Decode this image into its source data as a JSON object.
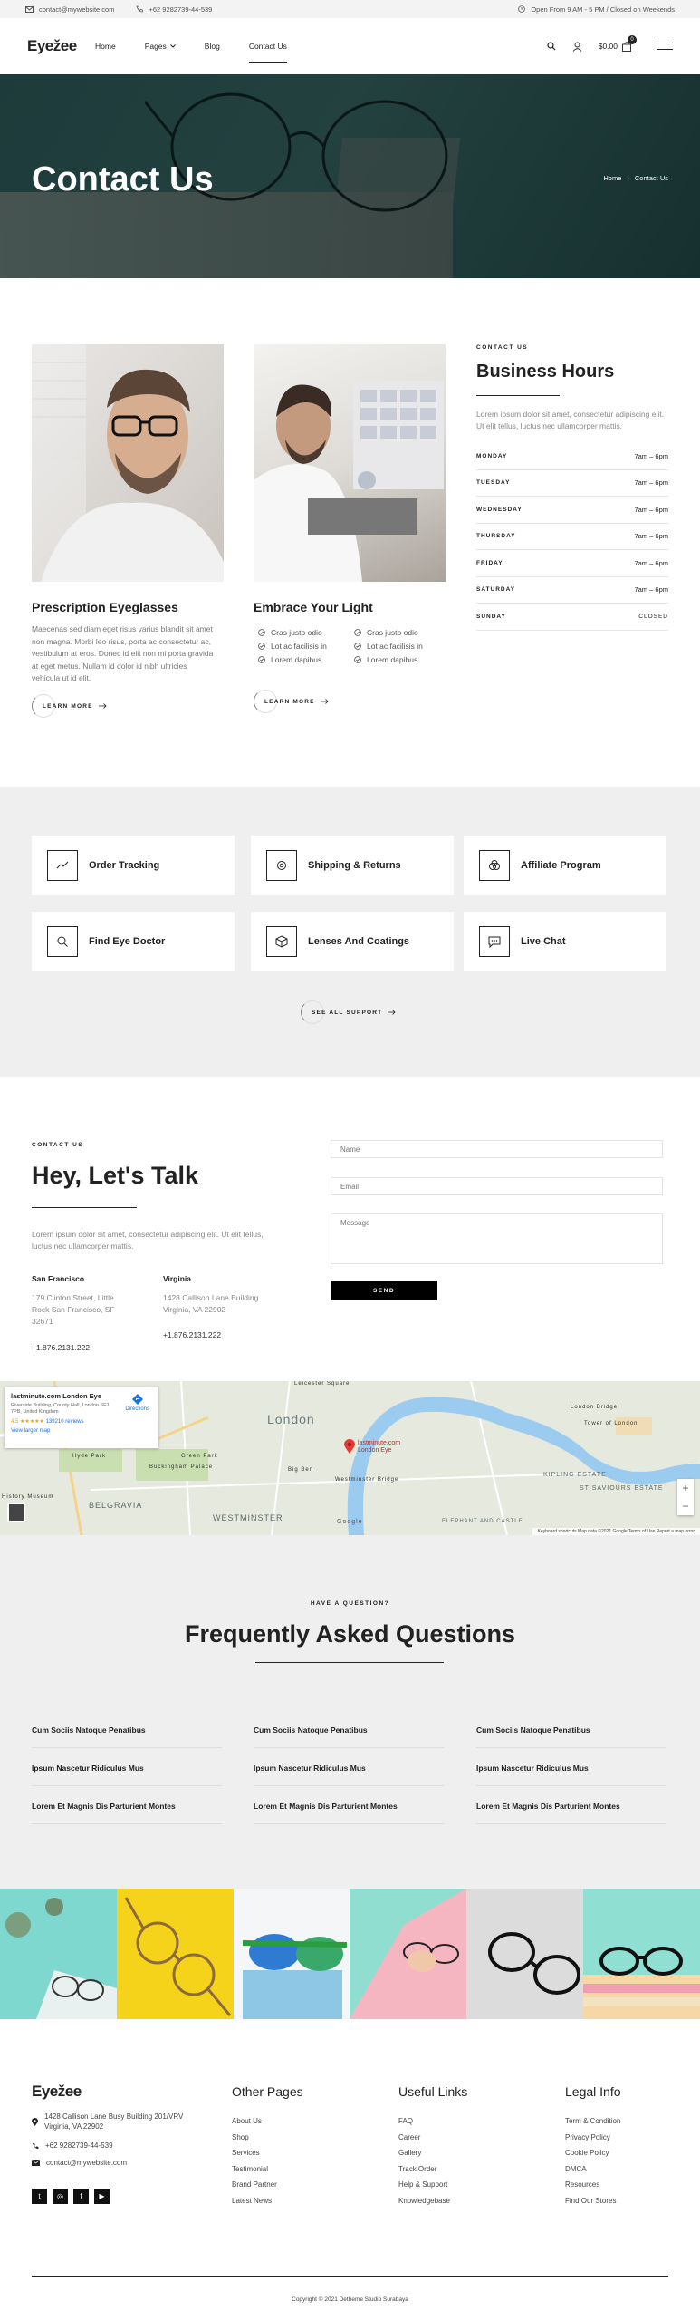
{
  "topbar": {
    "email": "contact@mywebsite.com",
    "phone": "+62 9282739-44-539",
    "hours": "Open From 9 AM - 5 PM / Closed on Weekends"
  },
  "nav": {
    "logo": "Eyežee",
    "items": [
      "Home",
      "Pages",
      "Blog",
      "Contact Us"
    ],
    "cart_total": "$0.00",
    "cart_count": "0"
  },
  "hero": {
    "title": "Contact Us",
    "breadcrumb_home": "Home",
    "breadcrumb_current": "Contact Us"
  },
  "features": [
    {
      "title": "Prescription Eyeglasses",
      "text": "Maecenas sed diam eget risus varius blandit sit amet non magna. Morbi leo risus, porta ac consectetur ac, vestibulum at eros. Donec id elit non mi porta gravida at eget metus. Nullam id dolor id nibh ultricies vehicula ut id elit.",
      "cta": "LEARN MORE"
    },
    {
      "title": "Embrace Your Light",
      "checks": [
        "Cras justo odio",
        "Cras justo odio",
        "Lot ac facilisis in",
        "Lot ac facilisis in",
        "Lorem dapibus",
        "Lorem dapibus"
      ],
      "cta": "LEARN MORE"
    }
  ],
  "hours": {
    "label": "CONTACT US",
    "title": "Business Hours",
    "text": "Lorem ipsum dolor sit amet, consectetur adipiscing elit. Ut elit tellus, luctus nec ullamcorper mattis.",
    "rows": [
      {
        "day": "MONDAY",
        "time": "7am – 6pm"
      },
      {
        "day": "TUESDAY",
        "time": "7am – 6pm"
      },
      {
        "day": "WEDNESDAY",
        "time": "7am – 6pm"
      },
      {
        "day": "THURSDAY",
        "time": "7am – 6pm"
      },
      {
        "day": "FRIDAY",
        "time": "7am – 6pm"
      },
      {
        "day": "SATURDAY",
        "time": "7am – 6pm"
      },
      {
        "day": "SUNDAY",
        "time": "CLOSED"
      }
    ]
  },
  "support": {
    "items": [
      "Order Tracking",
      "Shipping & Returns",
      "Affiliate Program",
      "Find Eye Doctor",
      "Lenses And Coatings",
      "Live Chat"
    ],
    "cta": "SEE ALL SUPPORT"
  },
  "talk": {
    "label": "CONTACT US",
    "title": "Hey, Let's Talk",
    "text": "Lorem ipsum dolor sit amet, consectetur adipiscing elit. Ut elit tellus, luctus nec ullamcorper mattis.",
    "offices": [
      {
        "city": "San Francisco",
        "address": "179 Clinton Street, Little Rock San Francisco, SF 32671",
        "phone": "+1.876.2131.222"
      },
      {
        "city": "Virginia",
        "address": "1428 Callison Lane Building Virginia, VA 22902",
        "phone": "+1.876.2131.222"
      }
    ],
    "form": {
      "name_placeholder": "Name",
      "email_placeholder": "Email",
      "message_placeholder": "Message",
      "send": "SEND"
    }
  },
  "map": {
    "place": "lastminute.com London Eye",
    "address": "Riverside Building, County Hall, London SE1 7PB, United Kingdom",
    "rating": "4.5 ★★★★★",
    "reviews": "139210 reviews",
    "larger": "View larger map",
    "directions": "Directions",
    "labels": [
      "London",
      "BELGRAVIA",
      "WESTMINSTER",
      "Buckingham Palace",
      "Big Ben",
      "Westminster Bridge",
      "London Bridge",
      "Tower of London",
      "Leicester Square",
      "Hyde Park",
      "Green Park",
      "KIPLING ESTATE",
      "ST SAVIOURS ESTATE",
      "ELEPHANT AND CASTLE",
      "History Museum",
      "Google"
    ],
    "pin_label": "lastminute.com London Eye",
    "footer": "Keyboard shortcuts   Map data ©2021 Google   Terms of Use   Report a map error"
  },
  "faq": {
    "label": "HAVE A QUESTION?",
    "title": "Frequently Asked Questions",
    "questions": [
      "Cum Sociis Natoque Penatibus",
      "Cum Sociis Natoque Penatibus",
      "Cum Sociis Natoque Penatibus",
      "Ipsum Nascetur Ridiculus Mus",
      "Ipsum Nascetur Ridiculus Mus",
      "Ipsum Nascetur Ridiculus Mus",
      "Lorem Et Magnis Dis Parturient Montes",
      "Lorem Et Magnis Dis Parturient Montes",
      "Lorem Et Magnis Dis Parturient Montes"
    ]
  },
  "footer": {
    "logo": "Eyežee",
    "address": "1428 Callison Lane Busy Building 201/VRV Virginia, VA 22902",
    "phone": "+62 9282739-44-539",
    "email": "contact@mywebsite.com",
    "social": [
      "t",
      "◎",
      "f",
      "▶"
    ],
    "columns": [
      {
        "title": "Other Pages",
        "links": [
          "About Us",
          "Shop",
          "Services",
          "Testimonial",
          "Brand Partner",
          "Latest News"
        ]
      },
      {
        "title": "Useful Links",
        "links": [
          "FAQ",
          "Career",
          "Gallery",
          "Track Order",
          "Help & Support",
          "Knowledgebase"
        ]
      },
      {
        "title": "Legal Info",
        "links": [
          "Term & Condition",
          "Privacy Policy",
          "Cookie Policy",
          "DMCA",
          "Resources",
          "Find Our Stores"
        ]
      }
    ],
    "copyright": "Copyright © 2021 Detheme Studio Surabaya"
  }
}
